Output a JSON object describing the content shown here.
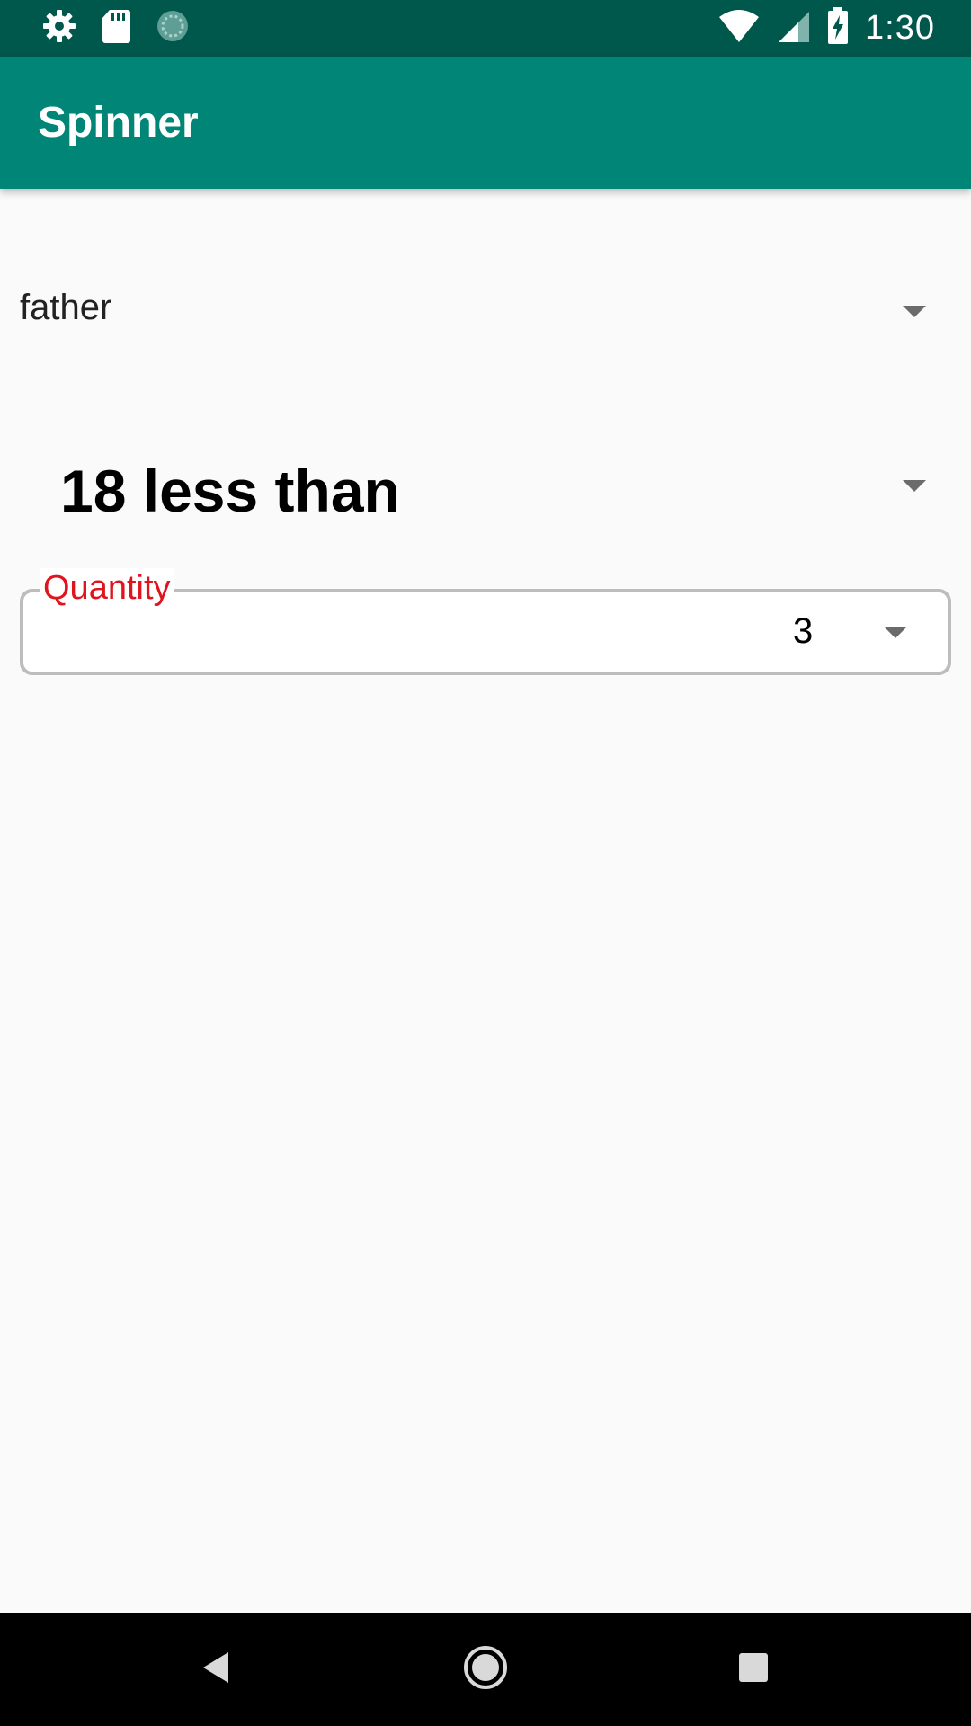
{
  "status_bar": {
    "time": "1:30",
    "left_icons": [
      "gear-icon",
      "sd-card-icon",
      "sync-icon"
    ],
    "right_icons": [
      "wifi-icon",
      "signal-icon",
      "battery-charging-icon"
    ]
  },
  "app_bar": {
    "title": "Spinner"
  },
  "spinner_relation": {
    "selected": "father"
  },
  "spinner_age": {
    "selected": "18 less than"
  },
  "spinner_quantity": {
    "label": "Quantity",
    "selected": "3"
  },
  "nav_bar": {
    "buttons": [
      "back-icon",
      "home-icon",
      "recents-icon"
    ]
  },
  "colors": {
    "status_bar": "#00574B",
    "app_bar": "#008577",
    "background": "#FAFAFA",
    "quantity_label": "#E0141E",
    "dropdown_arrow": "#6B6B6B"
  }
}
